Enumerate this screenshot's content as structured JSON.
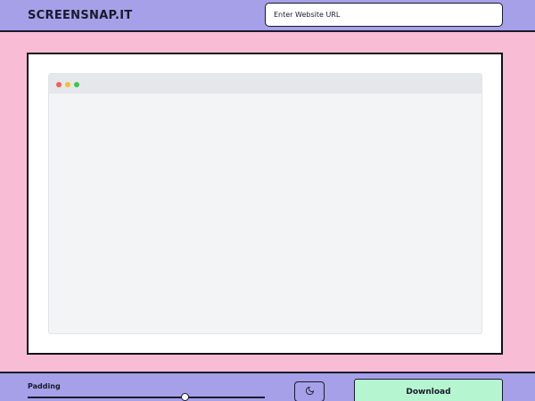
{
  "header": {
    "brand": "SCREENSNAP.IT",
    "url_placeholder": "Enter Website URL",
    "url_value": ""
  },
  "preview": {
    "window_dots": [
      "red-dot-icon",
      "yellow-dot-icon",
      "green-dot-icon"
    ]
  },
  "footer": {
    "padding_label": "Padding",
    "padding_value": 0.66,
    "theme_toggle_icon": "moon-icon",
    "download_label": "Download"
  },
  "colors": {
    "header_bg": "#a5a0e8",
    "page_bg": "#f8bcd4",
    "download_bg": "#b5f5cf",
    "dot_red": "#f0605b",
    "dot_yellow": "#f5c02f",
    "dot_green": "#39c64f"
  }
}
